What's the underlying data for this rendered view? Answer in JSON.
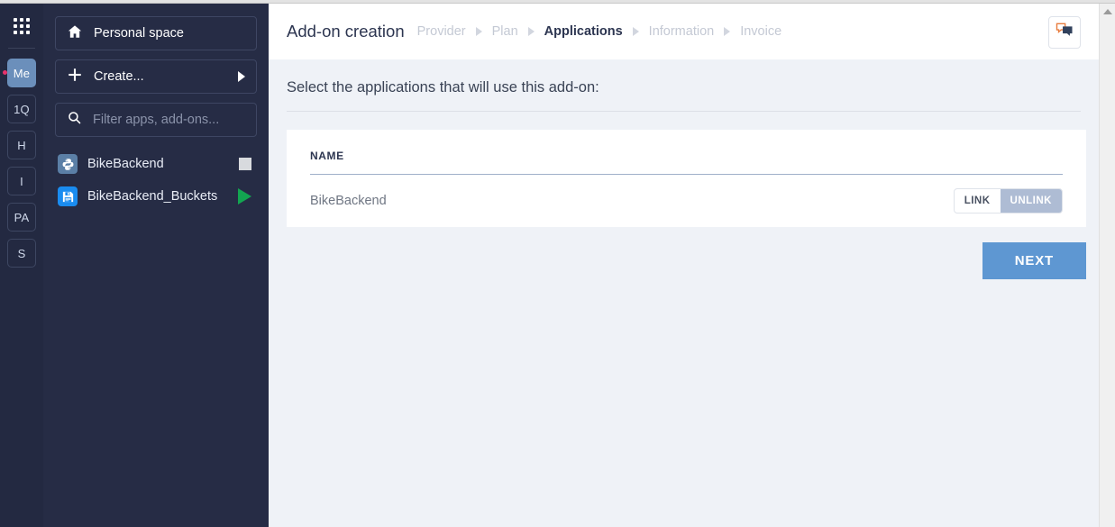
{
  "rail": {
    "apps_icon": "grid-apps-icon",
    "badges": [
      {
        "label": "Me",
        "active": true,
        "notification": true
      },
      {
        "label": "1Q",
        "active": false,
        "notification": false
      },
      {
        "label": "H",
        "active": false,
        "notification": false
      },
      {
        "label": "I",
        "active": false,
        "notification": false
      },
      {
        "label": "PA",
        "active": false,
        "notification": false
      },
      {
        "label": "S",
        "active": false,
        "notification": false
      }
    ]
  },
  "sidebar": {
    "personal_space": {
      "label": "Personal space",
      "icon": "home-icon"
    },
    "create": {
      "label": "Create...",
      "icon": "plus-icon",
      "caret": "caret-right-icon"
    },
    "filter": {
      "placeholder": "Filter apps, add-ons...",
      "value": "",
      "icon": "search-icon"
    },
    "apps": [
      {
        "name": "BikeBackend",
        "icon": "python-icon",
        "status": "stopped"
      },
      {
        "name": "BikeBackend_Buckets",
        "icon": "bucket-icon",
        "status": "running"
      }
    ]
  },
  "header": {
    "title": "Add-on creation",
    "chat_icon": "chat-bubbles-icon",
    "breadcrumb": [
      {
        "label": "Provider",
        "active": false
      },
      {
        "label": "Plan",
        "active": false
      },
      {
        "label": "Applications",
        "active": true
      },
      {
        "label": "Information",
        "active": false
      },
      {
        "label": "Invoice",
        "active": false
      }
    ]
  },
  "main": {
    "instruction": "Select the applications that will use this add-on:",
    "table": {
      "columns": [
        "NAME"
      ],
      "rows": [
        {
          "name": "BikeBackend",
          "link_label": "LINK",
          "unlink_label": "UNLINK",
          "selected": "UNLINK"
        }
      ]
    },
    "next_label": "NEXT"
  },
  "colors": {
    "rail_bg": "#232941",
    "sidebar_bg": "#262c45",
    "content_bg": "#eff2f7",
    "accent_blue": "#5e97d2",
    "toggle_active": "#aebcd4",
    "status_running": "#13a551",
    "status_stopped": "#d8dade",
    "notification_dot": "#e8336d"
  },
  "scrollbar": {
    "up_icon": "scroll-up-arrow-icon"
  }
}
